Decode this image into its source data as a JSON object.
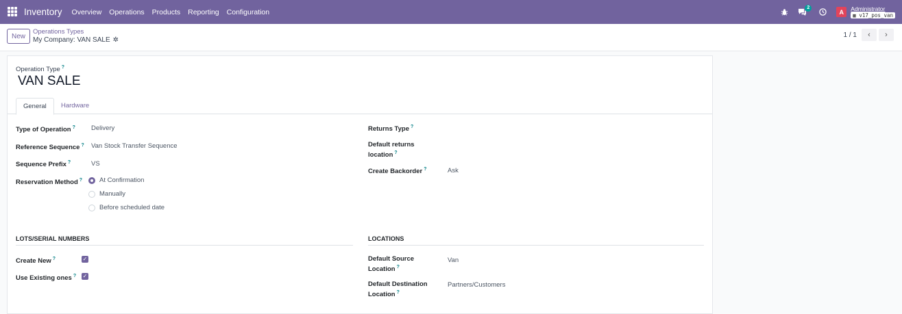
{
  "navbar": {
    "app_name": "Inventory",
    "menu": [
      "Overview",
      "Operations",
      "Products",
      "Reporting",
      "Configuration"
    ],
    "chat_badge": "2",
    "avatar_letter": "A",
    "user_name": "Administrator",
    "db_name": "v17_pos_van"
  },
  "control_panel": {
    "new_label": "New",
    "breadcrumb_parent": "Operations Types",
    "breadcrumb_current": "My Company: VAN SALE",
    "pager": "1 / 1"
  },
  "form": {
    "op_type_label": "Operation Type",
    "title": "VAN SALE",
    "tabs": [
      "General",
      "Hardware"
    ],
    "help_mark": "?",
    "left": {
      "type_of_operation_label": "Type of Operation",
      "type_of_operation_value": "Delivery",
      "reference_sequence_label": "Reference Sequence",
      "reference_sequence_value": "Van Stock Transfer Sequence",
      "sequence_prefix_label": "Sequence Prefix",
      "sequence_prefix_value": "VS",
      "reservation_method_label": "Reservation Method",
      "reservation_options": [
        "At Confirmation",
        "Manually",
        "Before scheduled date"
      ],
      "reservation_selected": "At Confirmation"
    },
    "right": {
      "returns_type_label": "Returns Type",
      "default_returns_label_1": "Default returns",
      "default_returns_label_2": "location",
      "create_backorder_label": "Create Backorder",
      "create_backorder_value": "Ask"
    },
    "lots": {
      "title": "LOTS/SERIAL NUMBERS",
      "create_new_label": "Create New",
      "create_new_checked": true,
      "use_existing_label": "Use Existing ones",
      "use_existing_checked": true
    },
    "locations": {
      "title": "LOCATIONS",
      "default_source_label_1": "Default Source",
      "default_source_label_2": "Location",
      "default_source_value": "Van",
      "default_dest_label_1": "Default Destination",
      "default_dest_label_2": "Location",
      "default_dest_value": "Partners/Customers"
    }
  },
  "colors": {
    "brand": "#71639e",
    "help": "#017e84"
  }
}
